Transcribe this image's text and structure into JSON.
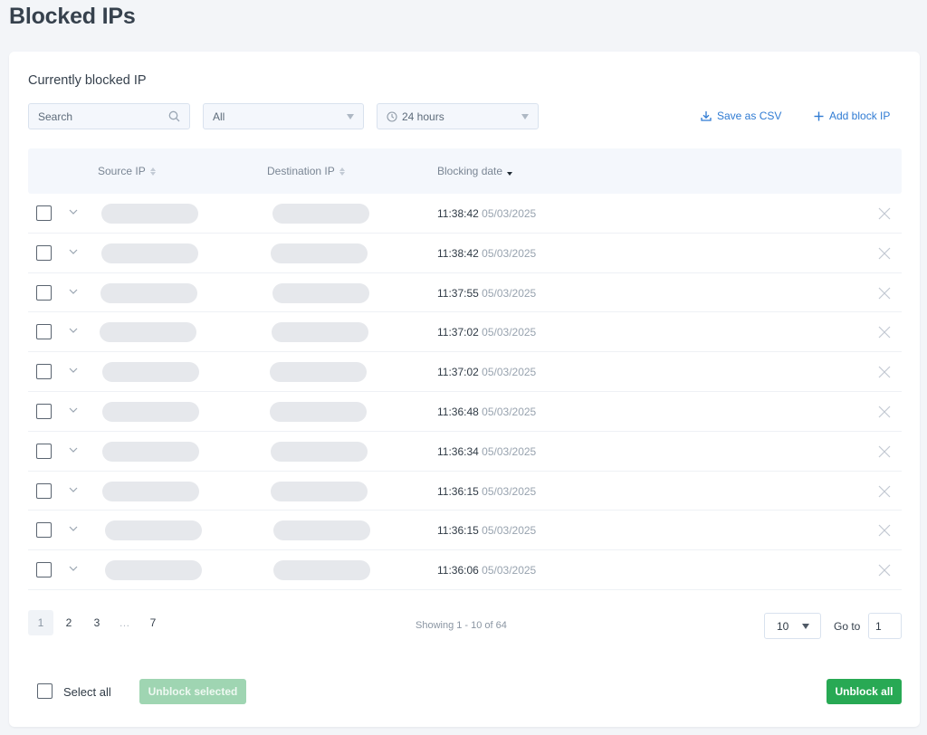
{
  "page": {
    "title": "Blocked IPs"
  },
  "card": {
    "title": "Currently blocked IP"
  },
  "toolbar": {
    "search_placeholder": "Search",
    "filter_value": "All",
    "time_value": "24 hours",
    "save_csv_label": "Save as CSV",
    "add_block_label": "Add block IP"
  },
  "table": {
    "columns": {
      "source_ip": "Source IP",
      "destination_ip": "Destination IP",
      "blocking_date": "Blocking date"
    },
    "rows": [
      {
        "time": "11:38:42",
        "date": "05/03/2025"
      },
      {
        "time": "11:38:42",
        "date": "05/03/2025"
      },
      {
        "time": "11:37:55",
        "date": "05/03/2025"
      },
      {
        "time": "11:37:02",
        "date": "05/03/2025"
      },
      {
        "time": "11:37:02",
        "date": "05/03/2025"
      },
      {
        "time": "11:36:48",
        "date": "05/03/2025"
      },
      {
        "time": "11:36:34",
        "date": "05/03/2025"
      },
      {
        "time": "11:36:15",
        "date": "05/03/2025"
      },
      {
        "time": "11:36:15",
        "date": "05/03/2025"
      },
      {
        "time": "11:36:06",
        "date": "05/03/2025"
      }
    ]
  },
  "pagination": {
    "pages": [
      "1",
      "2",
      "3"
    ],
    "ellipsis": "…",
    "last_page": "7",
    "current_page": "1",
    "showing": "Showing 1 - 10 of 64",
    "per_page": "10",
    "goto_label": "Go to",
    "goto_value": "1"
  },
  "footer": {
    "select_all_label": "Select all",
    "unblock_selected_label": "Unblock selected",
    "unblock_all_label": "Unblock all"
  },
  "colors": {
    "accent_link": "#2f7bd3",
    "primary_button": "#28a954",
    "disabled_button": "#9fd5b2"
  },
  "icons": {
    "search": "search-icon",
    "clock": "clock-icon",
    "download": "download-icon",
    "plus": "plus-icon",
    "expand": "chevron-down-icon",
    "remove": "close-icon"
  }
}
